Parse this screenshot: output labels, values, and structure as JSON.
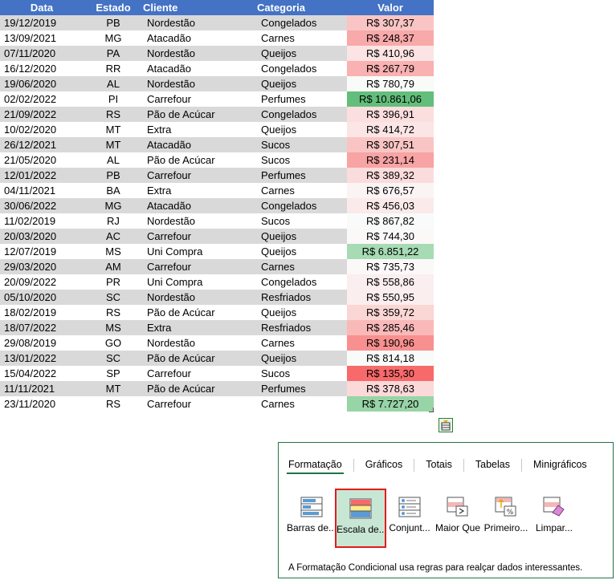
{
  "sheet": {
    "headers": [
      "Data",
      "Estado",
      "Cliente",
      "Categoria",
      "Valor"
    ],
    "rows": [
      [
        "19/12/2019",
        "PB",
        "Nordestão",
        "Congelados",
        "R$ 307,37",
        "#f9c5c4"
      ],
      [
        "13/09/2021",
        "MG",
        "Atacadão",
        "Carnes",
        "R$ 248,37",
        "#f8a9aa"
      ],
      [
        "07/11/2020",
        "PA",
        "Nordestão",
        "Queijos",
        "R$ 410,96",
        "#fbe4e3"
      ],
      [
        "16/12/2020",
        "RR",
        "Atacadão",
        "Congelados",
        "R$ 267,79",
        "#f9b1b1"
      ],
      [
        "19/06/2020",
        "AL",
        "Nordestão",
        "Queijos",
        "R$ 780,79",
        "#f8fbf8"
      ],
      [
        "02/02/2022",
        "PI",
        "Carrefour",
        "Perfumes",
        "R$ 10.861,06",
        "#63be7b"
      ],
      [
        "21/09/2022",
        "RS",
        "Pão de Acúcar",
        "Congelados",
        "R$ 396,91",
        "#fbdede"
      ],
      [
        "10/02/2020",
        "MT",
        "Extra",
        "Queijos",
        "R$ 414,72",
        "#fbe6e5"
      ],
      [
        "26/12/2021",
        "MT",
        "Atacadão",
        "Sucos",
        "R$ 307,51",
        "#f9c5c4"
      ],
      [
        "21/05/2020",
        "AL",
        "Pão de Acúcar",
        "Sucos",
        "R$ 231,14",
        "#f8a3a4"
      ],
      [
        "12/01/2022",
        "PB",
        "Carrefour",
        "Perfumes",
        "R$ 389,32",
        "#fbdcdc"
      ],
      [
        "04/11/2021",
        "BA",
        "Extra",
        "Carnes",
        "R$ 676,57",
        "#fbf4f4"
      ],
      [
        "30/06/2022",
        "MG",
        "Atacadão",
        "Congelados",
        "R$ 456,03",
        "#fbeaea"
      ],
      [
        "11/02/2019",
        "RJ",
        "Nordestão",
        "Sucos",
        "R$ 867,82",
        "#f8fbf9"
      ],
      [
        "20/03/2020",
        "AC",
        "Carrefour",
        "Queijos",
        "R$ 744,30",
        "#fbf8f8"
      ],
      [
        "12/07/2019",
        "MS",
        "Uni Compra",
        "Queijos",
        "R$ 6.851,22",
        "#a6dbb4"
      ],
      [
        "29/03/2020",
        "AM",
        "Carrefour",
        "Carnes",
        "R$ 735,73",
        "#fbf8f8"
      ],
      [
        "20/09/2022",
        "PR",
        "Uni Compra",
        "Congelados",
        "R$ 558,86",
        "#fbeeee"
      ],
      [
        "05/10/2020",
        "SC",
        "Nordestão",
        "Resfriados",
        "R$ 550,95",
        "#fbeeee"
      ],
      [
        "18/02/2019",
        "RS",
        "Pão de Acúcar",
        "Queijos",
        "R$ 359,72",
        "#fad6d5"
      ],
      [
        "18/07/2022",
        "MS",
        "Extra",
        "Resfriados",
        "R$ 285,46",
        "#f9b9b9"
      ],
      [
        "29/08/2019",
        "GO",
        "Nordestão",
        "Carnes",
        "R$ 190,96",
        "#f8908f"
      ],
      [
        "13/01/2022",
        "SC",
        "Pão de Acúcar",
        "Queijos",
        "R$ 814,18",
        "#f8fbf8"
      ],
      [
        "15/04/2022",
        "SP",
        "Carrefour",
        "Sucos",
        "R$ 135,30",
        "#f8696b"
      ],
      [
        "11/11/2021",
        "MT",
        "Pão de Acúcar",
        "Perfumes",
        "R$ 378,63",
        "#fad9d8"
      ],
      [
        "23/11/2020",
        "RS",
        "Carrefour",
        "Carnes",
        "R$ 7.727,20",
        "#97d4a6"
      ]
    ]
  },
  "quick_analysis": {
    "tabs": [
      "Formatação",
      "Gráficos",
      "Totais",
      "Tabelas",
      "Minigráficos"
    ],
    "active_tab": "Formatação",
    "options": [
      "Barras de...",
      "Escala de...",
      "Conjunt...",
      "Maior Que",
      "Primeiro...",
      "Limpar..."
    ],
    "selected_option": "Escala de...",
    "description": "A Formatação Condicional usa regras para realçar dados interessantes."
  },
  "colors": {
    "header": "#4472c4",
    "band": "#d9d9d9",
    "panel_border": "#217346",
    "selection": "#e21c1c"
  }
}
